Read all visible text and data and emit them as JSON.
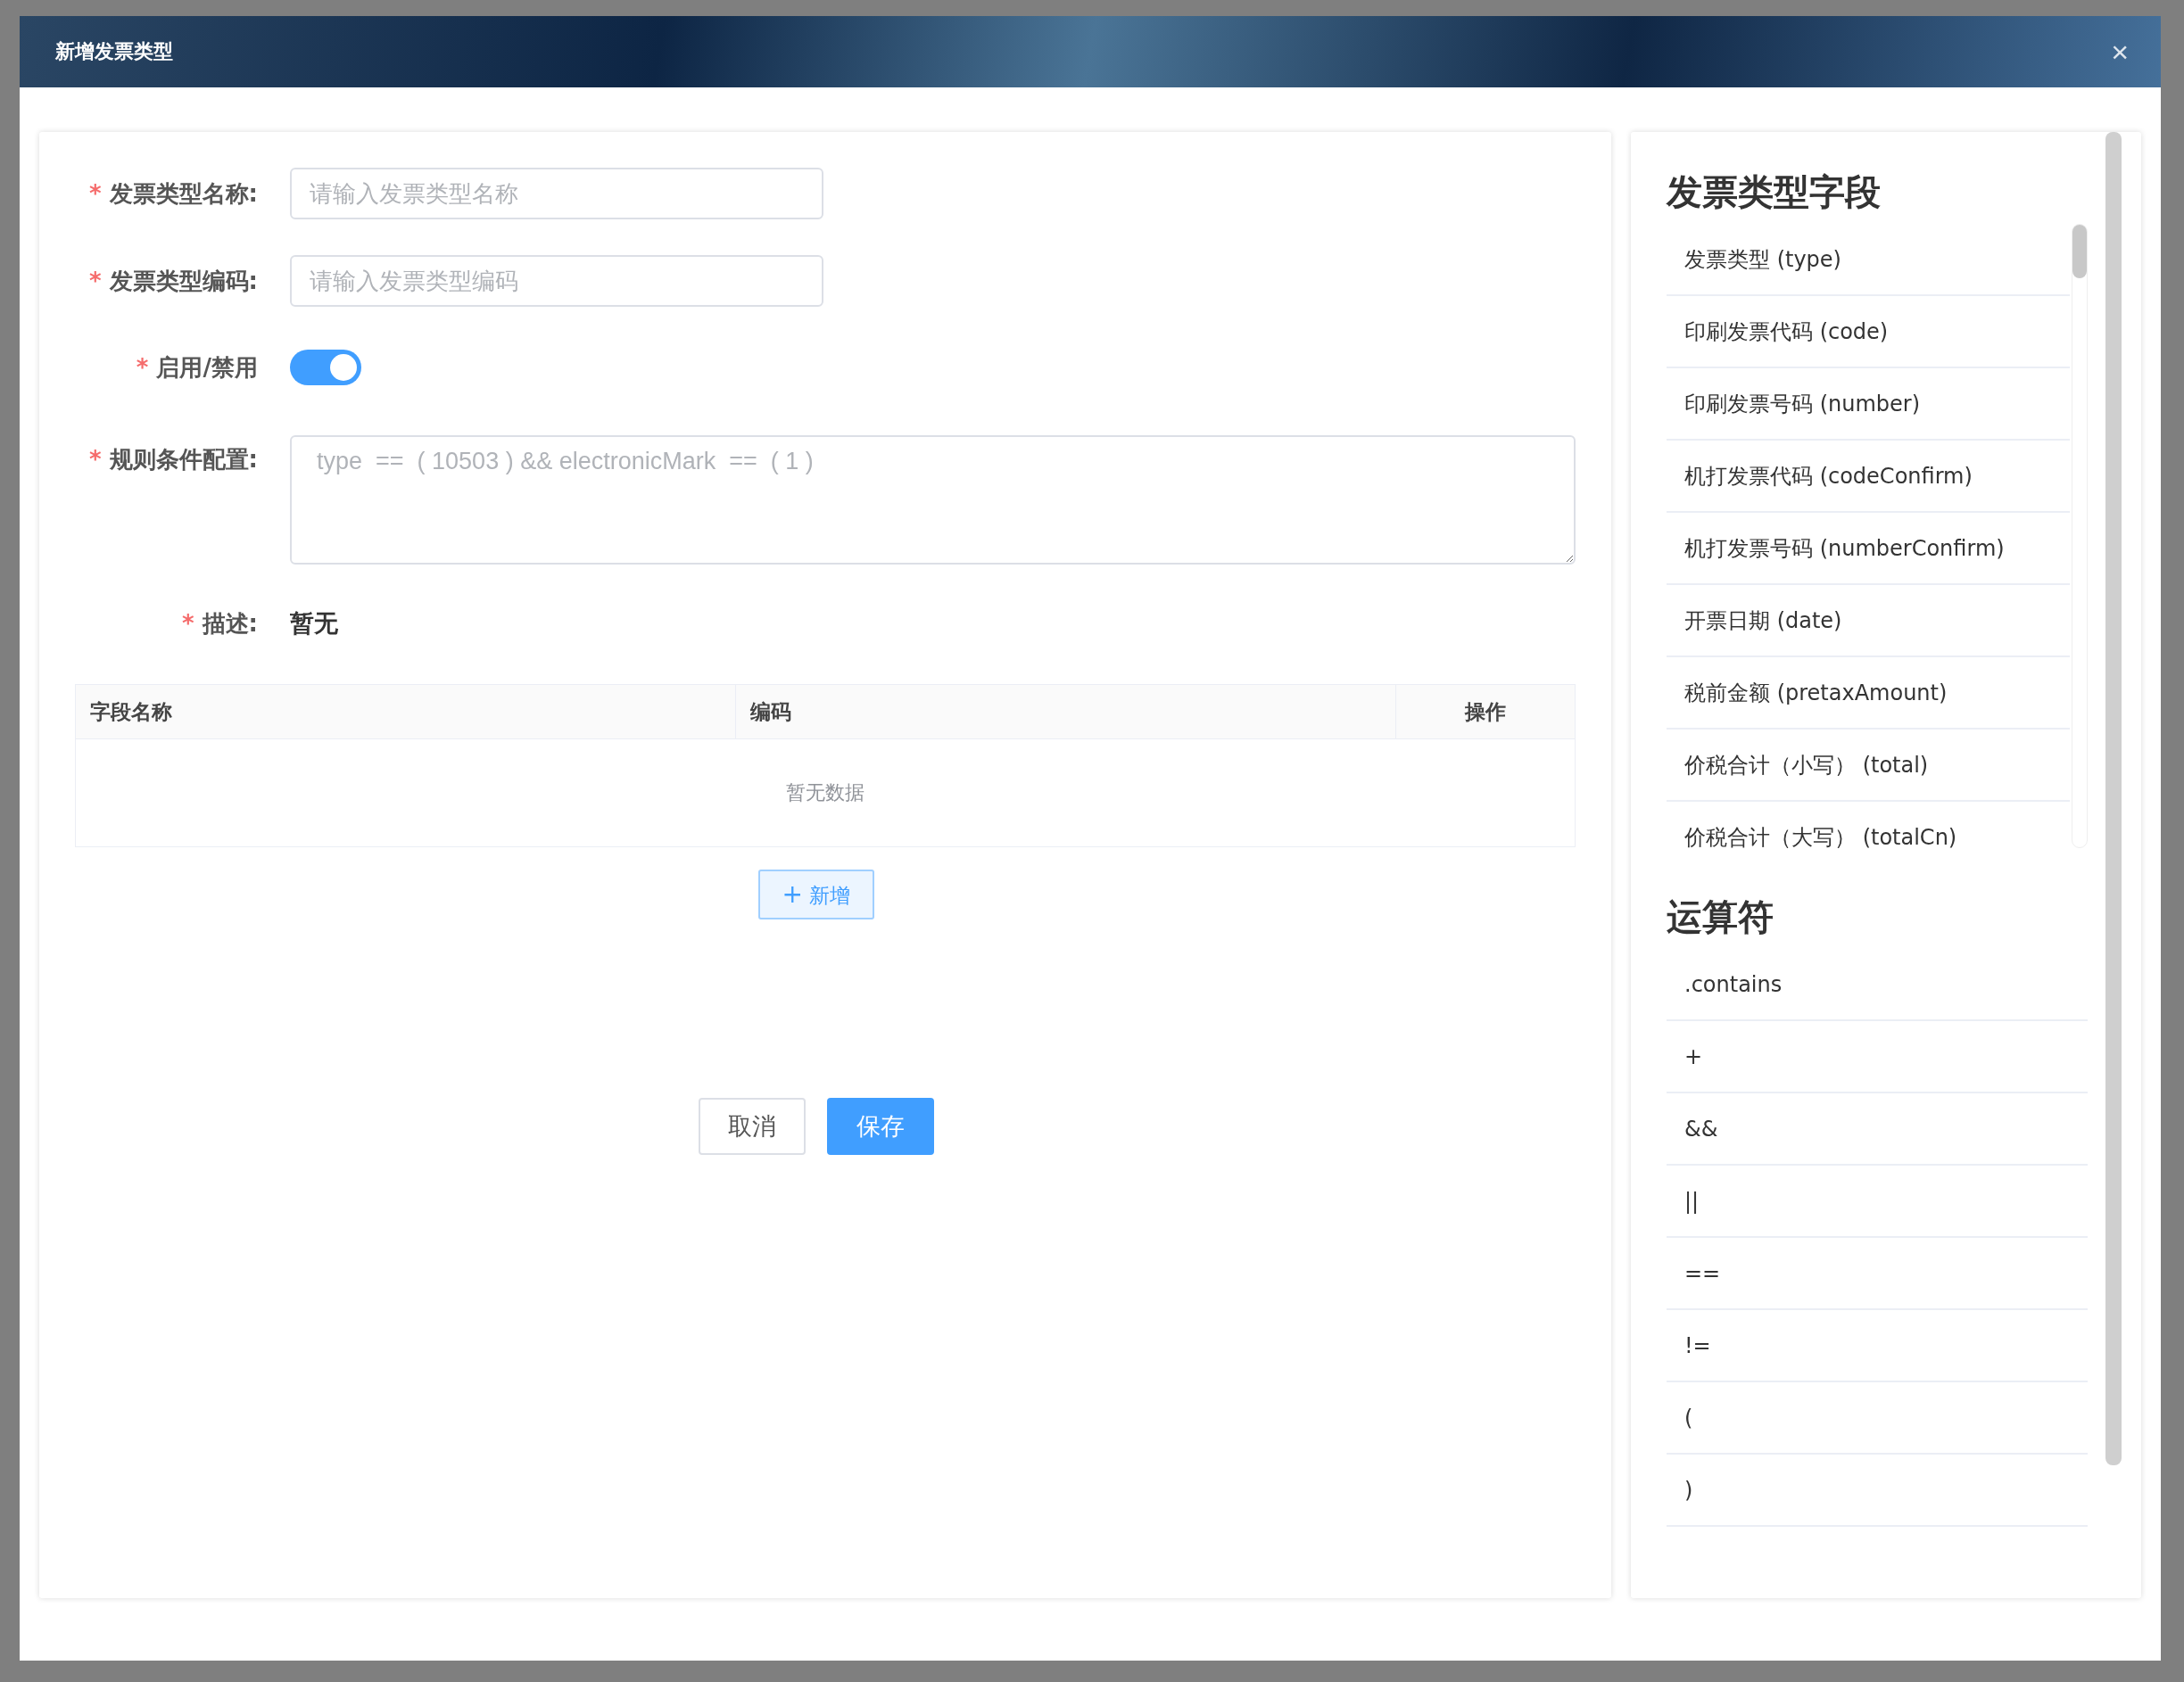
{
  "dialog": {
    "title": "新增发票类型",
    "close": "×"
  },
  "form": {
    "fields": [
      {
        "kind": "input",
        "required_mark": "*",
        "label": "发票类型名称:",
        "placeholder": "请输入发票类型名称"
      },
      {
        "kind": "input",
        "required_mark": "*",
        "label": "发票类型编码:",
        "placeholder": "请输入发票类型编码"
      },
      {
        "kind": "switch",
        "required_mark": "*",
        "label": "启用/禁用",
        "on": true
      },
      {
        "kind": "textarea",
        "required_mark": "*",
        "label": "规则条件配置:",
        "placeholder": "type  ==  ( 10503 ) && electronicMark  ==  ( 1 )"
      },
      {
        "kind": "text",
        "required_mark": "*",
        "label": "描述:",
        "value": "暂无"
      }
    ]
  },
  "table": {
    "columns": [
      "字段名称",
      "编码",
      "操作"
    ],
    "empty_text": "暂无数据",
    "add_button": {
      "icon": "+",
      "label": "新增"
    }
  },
  "buttons": [
    {
      "label": "取消",
      "kind": "default"
    },
    {
      "label": "保存",
      "kind": "primary"
    }
  ],
  "sidebar": {
    "sections": [
      {
        "title": "发票类型字段",
        "scroll": true,
        "items": [
          "发票类型 (type)",
          "印刷发票代码 (code)",
          "印刷发票号码 (number)",
          "机打发票代码 (codeConfirm)",
          "机打发票号码 (numberConfirm)",
          "开票日期 (date)",
          "税前金额 (pretaxAmount)",
          "价税合计（小写） (total)",
          "价税合计（大写） (totalCn)"
        ]
      },
      {
        "title": "运算符",
        "items": [
          ".contains",
          "+",
          "&&",
          "||",
          "==",
          "!=",
          "(",
          ")"
        ]
      }
    ]
  }
}
